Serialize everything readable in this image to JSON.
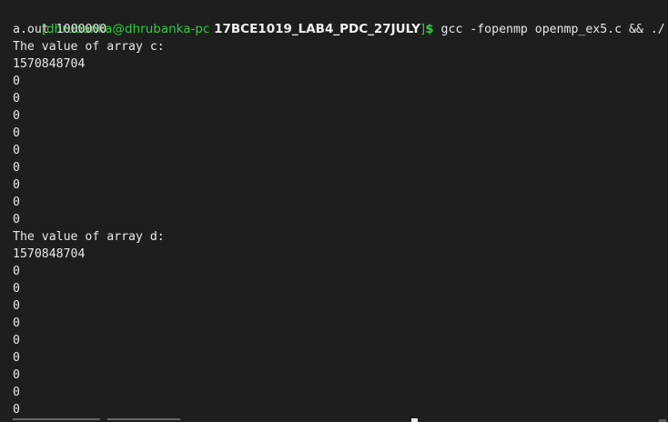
{
  "prompt": {
    "open_bracket": "[",
    "user_host": "dhrubanka@dhrubanka-pc",
    "space": " ",
    "directory": "17BCE1019_LAB4_PDC_27JULY",
    "close_bracket": "]",
    "dollar": "$",
    "command": " gcc -fopenmp openmp_ex5.c && ./",
    "command_wrap": "a.out 1000000"
  },
  "output": {
    "header_c": "The value of array c:",
    "values_c": [
      "1570848704",
      "0",
      "0",
      "0",
      "0",
      "0",
      "0",
      "0",
      "0",
      "0"
    ],
    "header_d": "The value of array d:",
    "values_d": [
      "1570848704",
      "0",
      "0",
      "0",
      "0",
      "0",
      "0",
      "0",
      "0",
      "0"
    ]
  },
  "colors": {
    "background": "#1e1e1e",
    "prompt_green": "#2ecc40",
    "text": "#e8e8e8"
  }
}
